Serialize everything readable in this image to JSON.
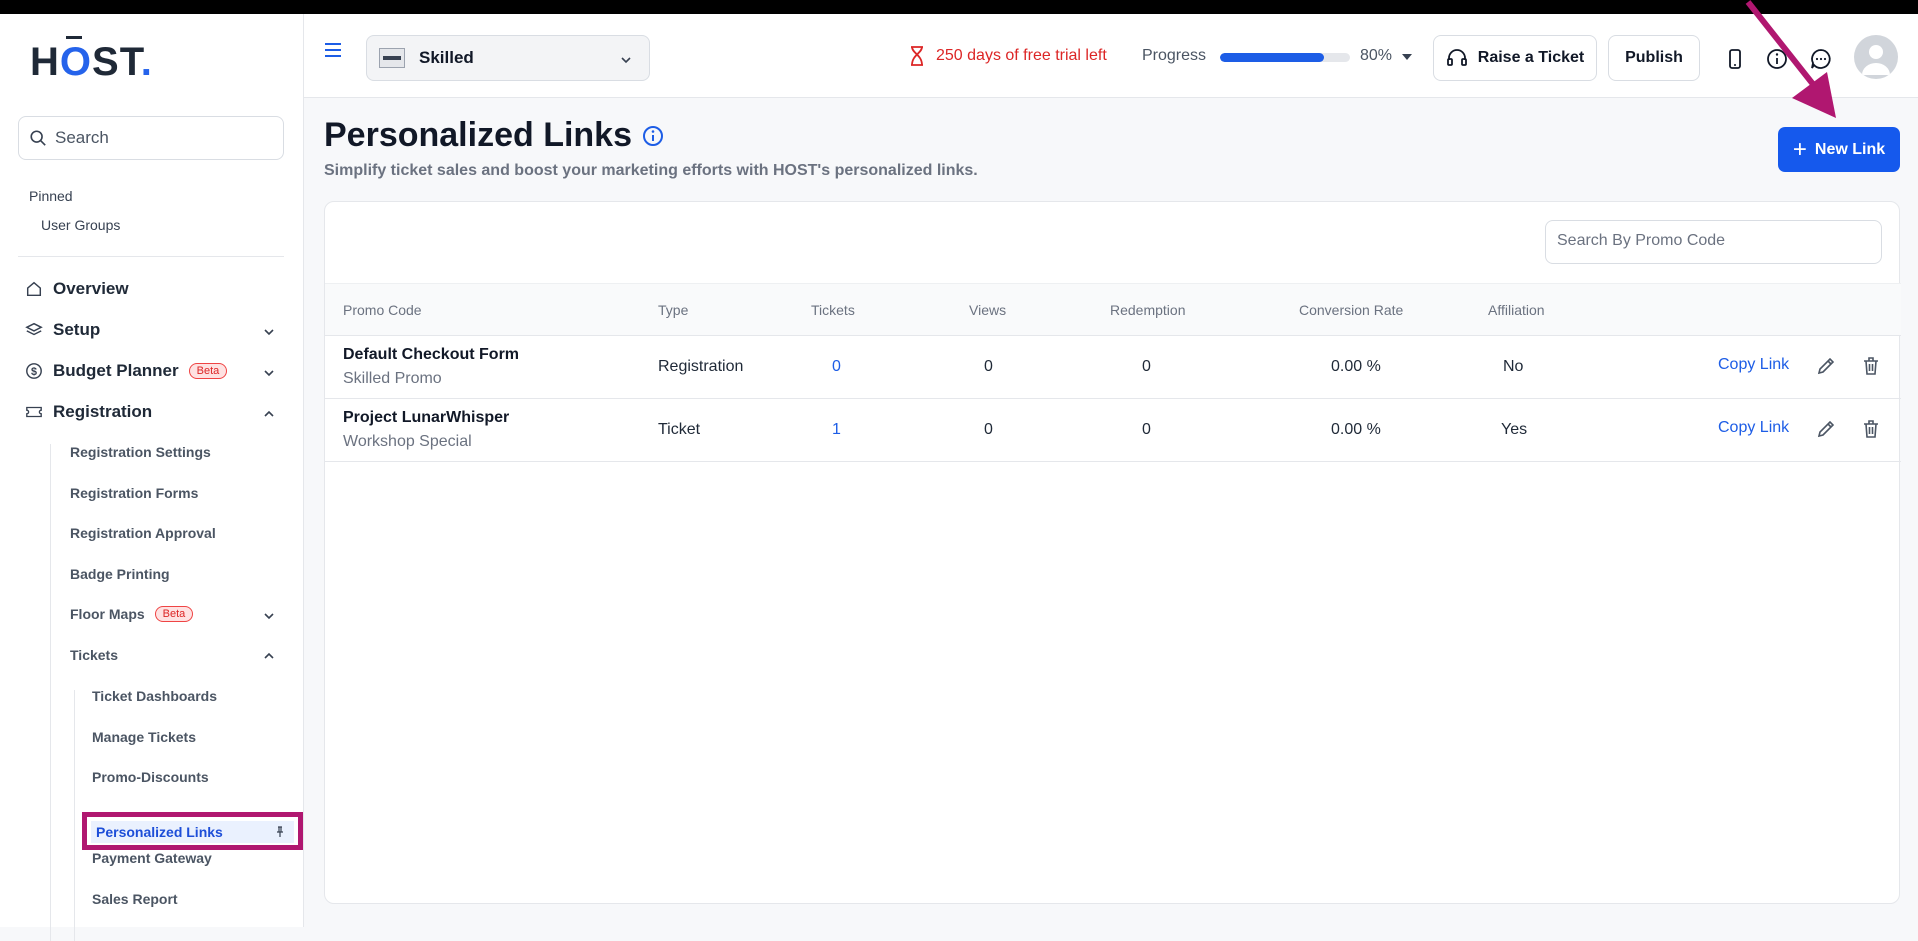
{
  "logo": {
    "text": "HOST",
    "dot": "."
  },
  "sidebar": {
    "search_placeholder": "Search",
    "pinned_title": "Pinned",
    "pinned_items": [
      "User Groups"
    ],
    "nav": {
      "overview": "Overview",
      "setup": "Setup",
      "budget_planner": "Budget Planner",
      "beta": "Beta",
      "registration": "Registration",
      "registration_settings": "Registration Settings",
      "registration_forms": "Registration Forms",
      "registration_approval": "Registration Approval",
      "badge_printing": "Badge Printing",
      "floor_maps": "Floor Maps",
      "tickets": "Tickets",
      "ticket_dashboards": "Ticket Dashboards",
      "manage_tickets": "Manage Tickets",
      "promo_discounts": "Promo-Discounts",
      "personalized_links": "Personalized Links",
      "payment_gateway": "Payment Gateway",
      "sales_report": "Sales Report"
    }
  },
  "header": {
    "event_name": "Skilled",
    "trial_text": "250 days of free trial left",
    "progress_label": "Progress",
    "progress_value": 0.8,
    "progress_pct": "80%",
    "raise_ticket": "Raise a Ticket",
    "publish": "Publish"
  },
  "main": {
    "title": "Personalized Links",
    "subtitle": "Simplify ticket sales and boost your marketing efforts with HOST's personalized links.",
    "new_link": "New Link",
    "promo_search_placeholder": "Search By Promo Code",
    "columns": [
      "Promo Code",
      "Type",
      "Tickets",
      "Views",
      "Redemption",
      "Conversion Rate",
      "Affiliation"
    ],
    "rows": [
      {
        "name": "Default Checkout Form",
        "sub": "Skilled Promo",
        "type": "Registration",
        "tickets": "0",
        "views": "0",
        "redemption": "0",
        "conversion": "0.00 %",
        "affiliation": "No",
        "copy": "Copy Link"
      },
      {
        "name": "Project LunarWhisper",
        "sub": "Workshop Special",
        "type": "Ticket",
        "tickets": "1",
        "views": "0",
        "redemption": "0",
        "conversion": "0.00 %",
        "affiliation": "Yes",
        "copy": "Copy Link"
      }
    ]
  },
  "colors": {
    "accent": "#1559ed",
    "highlight": "#b01770",
    "trial": "#dc2626"
  }
}
